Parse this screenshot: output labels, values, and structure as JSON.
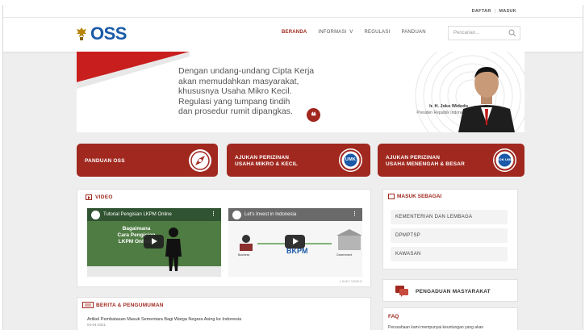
{
  "topbar": {
    "daftar": "DAFTAR",
    "sep": "|",
    "masuk": "MASUK"
  },
  "nav": {
    "items": [
      "BERANDA",
      "INFORMASI",
      "REGULASI",
      "PANDUAN"
    ],
    "informasi_chevron": "V",
    "search_placeholder": "Pencarian..."
  },
  "logo": {
    "text": "OSS"
  },
  "hero": {
    "quote_lines": [
      "Dengan undang-undang Cipta Kerja",
      "akan memudahkan masyarakat,",
      "khususnya Usaha Mikro Kecil.",
      "Regulasi yang tumpang tindih",
      "dan prosedur rumit dipangkas."
    ],
    "name": "Ir. H. Joko Widodo",
    "title": "Presiden Republik Indonesia"
  },
  "cards": [
    {
      "label1": "PANDUAN OSS",
      "label2": ""
    },
    {
      "label1": "AJUKAN PERIZINAN",
      "label2": "USAHA MIKRO & KECIL",
      "badge": "UMK"
    },
    {
      "label1": "AJUKAN PERIZINAN",
      "label2": "USAHA MENENGAH & BESAR",
      "badge": "NON UMK"
    }
  ],
  "video": {
    "heading": "VIDEO",
    "items": [
      {
        "title": "Tutorial Pengisian LKPM Online",
        "overlay1": "Bagaimana",
        "overlay2": "Cara Pengisian",
        "overlay3": "LKPM Online?"
      },
      {
        "title": "Let's Invest in Indonesia",
        "caption_left": "Business",
        "caption_center": "BKPM",
        "caption_right": "Government"
      }
    ],
    "more": "LIHAT VIDEO"
  },
  "masuk": {
    "heading": "MASUK SEBAGAI",
    "options": [
      "KEMENTERIAN DAN LEMBAGA",
      "DPMPTSP",
      "KAWASAN"
    ]
  },
  "pengaduan": {
    "label": "PENGADUAN MASYARAKAT"
  },
  "berita": {
    "heading": "BERITA & PENGUMUMAN",
    "item": "Artikel Pembatasan Masuk Sementara Bagi Warga Negara Asing ke Indonesia",
    "date": "04-04-2021"
  },
  "faq": {
    "heading": "FAQ",
    "question": "Perusahaan kami mempunyai keuntungan yang akan"
  },
  "colors": {
    "brand_red": "#a0281f",
    "brand_blue": "#1a5aa8"
  }
}
